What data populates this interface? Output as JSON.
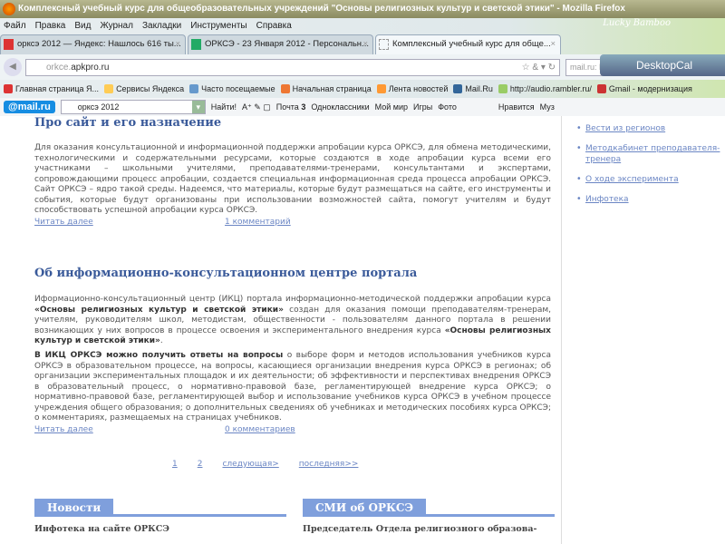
{
  "window": {
    "title": "Комплексный учебный курс для общеобразовательных учреждений \"Основы религиозных культур и светской этики\" - Mozilla Firefox",
    "theme_label": "Lucky Bamboo"
  },
  "menu": [
    "Файл",
    "Правка",
    "Вид",
    "Журнал",
    "Закладки",
    "Инструменты",
    "Справка"
  ],
  "tabs": [
    {
      "label": "оркcэ 2012 — Яндекс: Нашлось 616 ты..."
    },
    {
      "label": "ОРКСЭ - 23 Января 2012 - Персональн..."
    },
    {
      "label": "Комплексный учебный курс для обще..."
    }
  ],
  "nav": {
    "url_prefix": "orkce.",
    "url_domain": "apkpro.ru",
    "search_placeholder": "mail.ru: Поиск в интернете",
    "desktopcal": "DesktopCal"
  },
  "bookmarks": [
    "Главная страница Я...",
    "Сервисы Яндекса",
    "Часто посещаемые",
    "Начальная страница",
    "Лента новостей",
    "Mail.Ru",
    "http://audio.rambler.ru/",
    "Gmail - модернизация"
  ],
  "mailbar": {
    "logo": "@mail.ru",
    "query": "оркcэ 2012",
    "find": "Найти!",
    "mail": "Почта",
    "mail_count": "3",
    "items": [
      "Одноклассники",
      "Мой мир",
      "Игры",
      "Фото",
      "Нравится",
      "Муз"
    ]
  },
  "articles": [
    {
      "title": "Про сайт и его  назначение",
      "text": "Для оказания консультационной и информационной поддержки апробации курса ОРКСЭ, для обмена методическими, технологическими и содержательными ресурсами, которые  создаются в ходе апробации курса  всеми его участниками – школьными учителями, преподавателями-тренерами, консультантами и экспертами, сопровождающими процесс апробации, создается  специальная информационная среда  процесса апробации ОРКСЭ. Сайт ОРКСЭ – ядро такой среды.  Надеемся, что материалы, которые будут размещаться на сайте, его инструменты и события, которые будут организованы при использовании возможностей сайта, помогут учителям и будут способствовать успешной апробации курса ОРКСЭ.",
      "more": "Читать далее",
      "comments": "1 комментарий"
    },
    {
      "title": "Об  информационно-консультационном центре портала",
      "p1_a": "Иформационно-консультационный центр (ИКЦ) портала информационно-методической поддержки апробации курса ",
      "p1_b": "«Основы религиозных культур и светской этики»",
      "p1_c": " создан для оказания помощи преподавателям-тренерам, учителям, руководителям школ, методистам, общественности - пользователям данного портала в решении возникающих у них вопросов в процессе освоения и экспериментального внедрения курса ",
      "p1_d": "«Основы религиозных культур и светской этики»",
      "p1_e": ".",
      "p2_b": "В ИКЦ ОРКСЭ можно получить ответы на вопросы",
      "p2_c": " о выборе форм и методов использования учебников курса ОРКСЭ в образовательном процессе, на вопросы, касающиеся организации внедрения курса ОРКСЭ в регионах; об организации экспериментальных площадок и их деятельности; об эффективности и перспективах внедрения ОРКСЭ в образовательный процесс, о нормативно-правовой базе, регламентирующей внедрение курса ОРКСЭ; о нормативно-правовой базе, регламентирующей выбор и использование учебников курса ОРКСЭ в учебном процессе учреждения общего образования; о дополнительных сведениях об учебниках и методических пособиях  курса ОРКСЭ; о  комментариях, размещаемых на страницах учебников.",
      "more": "Читать далее",
      "comments": "0 комментариев"
    }
  ],
  "pager": [
    "1",
    "2",
    "следующая>",
    "последняя>>"
  ],
  "sidebar": [
    "Вести из регионов",
    "Методкабинет преподавателя-тренера",
    "О ходе эксперимента",
    "Инфотека"
  ],
  "sections": {
    "news": {
      "title": "Новости",
      "item": "Инфотека на сайте ОРКСЭ"
    },
    "media": {
      "title": "СМИ об ОРКСЭ",
      "item": "Председатель Отдела религиозного образова-"
    }
  }
}
